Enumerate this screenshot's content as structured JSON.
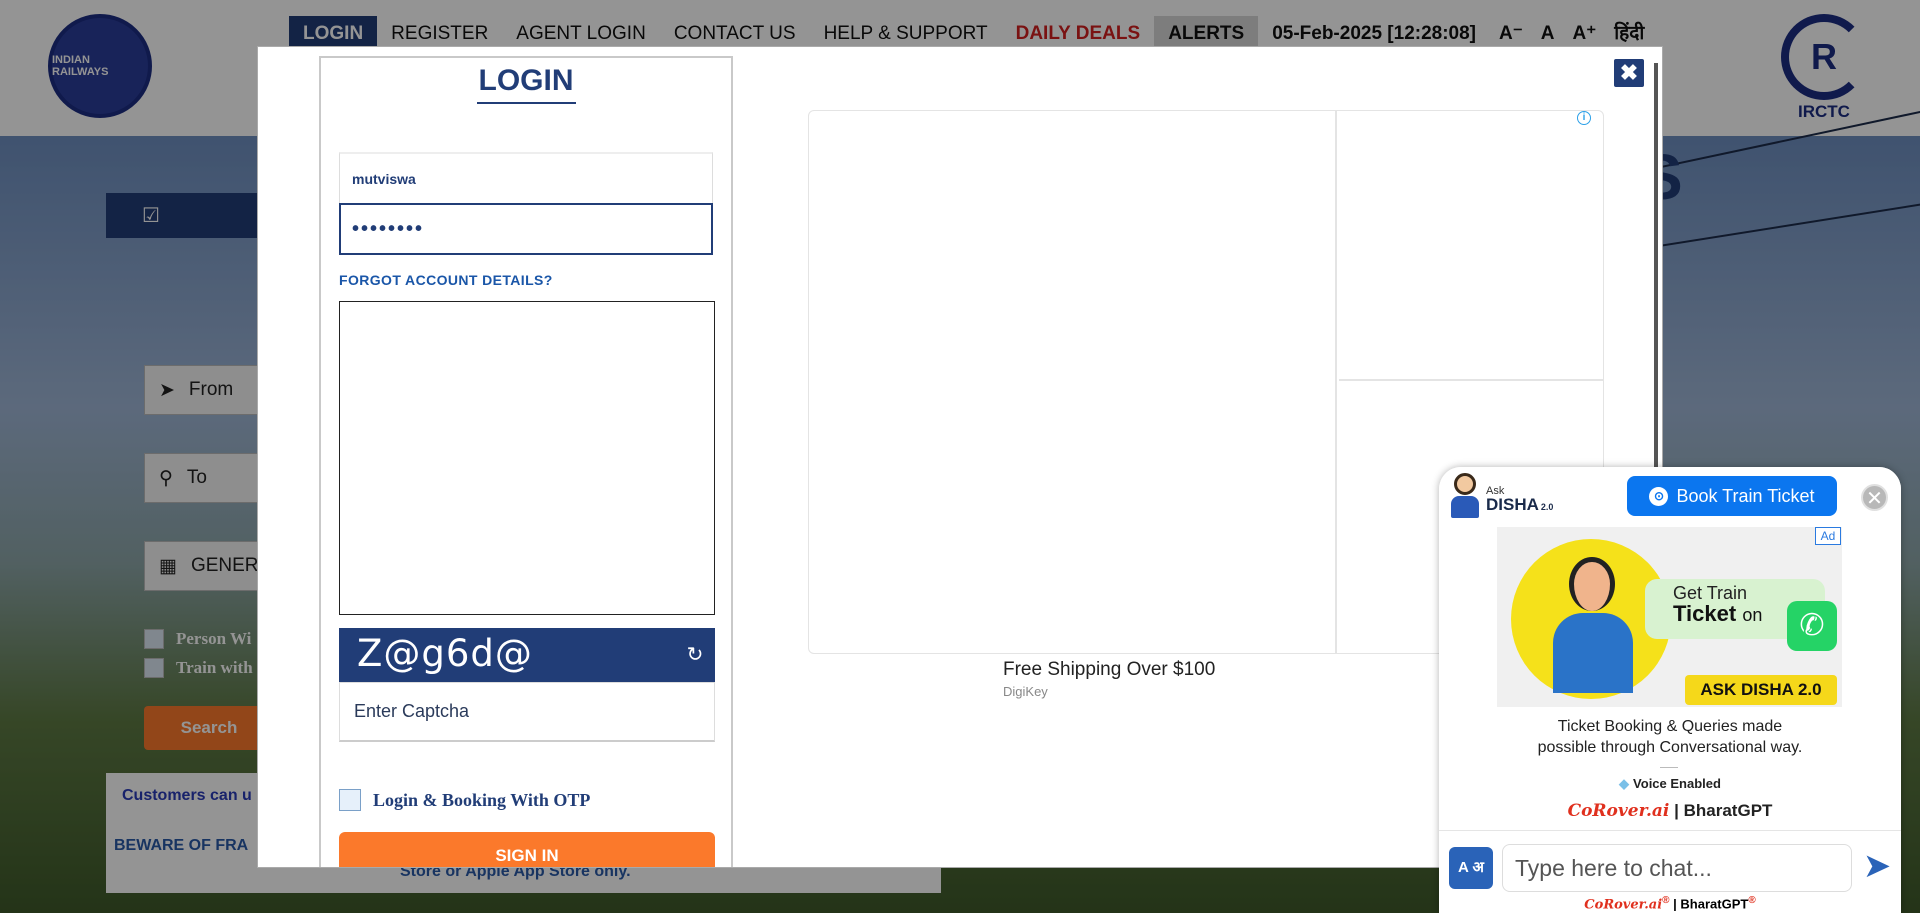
{
  "header": {
    "ir_logo_text": "INDIAN RAILWAYS",
    "irctc_logo_text": "IRCTC",
    "nav": {
      "login": "LOGIN",
      "register": "REGISTER",
      "agent_login": "AGENT LOGIN",
      "contact_us": "CONTACT US",
      "help_support": "HELP & SUPPORT",
      "daily_deals": "DAILY DEALS",
      "alerts": "ALERTS",
      "datetime": "05-Feb-2025 [12:28:08]",
      "font_small": "A⁻",
      "font_normal": "A",
      "font_large": "A⁺",
      "hindi": "हिंदी"
    }
  },
  "background": {
    "from_label": "From",
    "to_label": "To",
    "class_label": "GENERA",
    "check_person": "Person Wi",
    "check_train": "Train with",
    "search_label": "Search",
    "notice_line1": "Customers can u",
    "notice_line2": "BEWARE OF FRA",
    "notice_line3": "Store or Apple App Store only.",
    "big_letter": "S"
  },
  "modal": {
    "close_label": "✖",
    "login_title": "LOGIN",
    "username_value": "mutviswa",
    "password_value": "••••••••",
    "forgot_link": "FORGOT ACCOUNT DETAILS?",
    "captcha_text": "Z@g6d@",
    "captcha_placeholder": "Enter Captcha",
    "otp_label": "Login & Booking With OTP",
    "signin_label": "SIGN IN",
    "ad": {
      "info_icon": "i",
      "caption": "Free Shipping Over $100",
      "source": "DigiKey"
    }
  },
  "chat": {
    "ask_label": "Ask",
    "disha_name": "DISHA",
    "disha_version": "2.0",
    "book_button": "Book Train Ticket",
    "close_label": "✕",
    "ad_badge": "Ad",
    "promo": {
      "get": "Get Train",
      "ticket": "Ticket",
      "on": "on",
      "ask_badge": "ASK DISHA 2.0"
    },
    "desc_line1": "Ticket Booking & Queries made",
    "desc_line2": "possible through Conversational way.",
    "voice_label": "Voice Enabled",
    "brand_corover": "CoRover.ai",
    "brand_sep": "|",
    "brand_bharat": "BharatGPT",
    "translate_label": "A अ",
    "input_placeholder": "Type here to chat...",
    "powered_corover": "CoRover.ai",
    "powered_reg": "®",
    "powered_bharat": "BharatGPT"
  },
  "colors": {
    "primary_navy": "#213d77",
    "accent_orange": "#fb792b",
    "deals_red": "#d21f1f",
    "chat_blue": "#0b76ef"
  }
}
